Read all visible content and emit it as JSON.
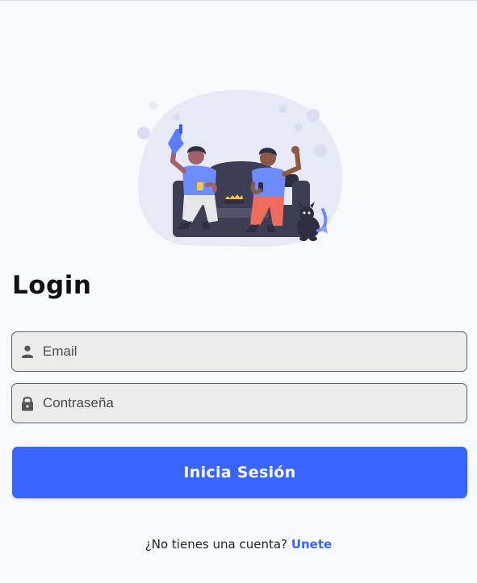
{
  "login": {
    "title": "Login",
    "email": {
      "placeholder": "Email",
      "value": "",
      "icon": "person-icon"
    },
    "password": {
      "placeholder": "Contraseña",
      "value": "",
      "icon": "lock-icon"
    },
    "submit_label": "Inicia Sesión",
    "signup_prompt": "¿No tienes una cuenta?",
    "signup_link": "Unete"
  },
  "colors": {
    "accent": "#3865ff",
    "background": "#f8f9fd",
    "field_background": "#ececec"
  }
}
